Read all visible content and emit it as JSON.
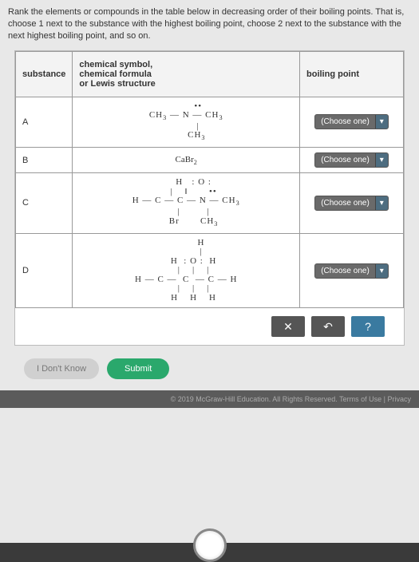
{
  "instructions": "Rank the elements or compounds in the table below in decreasing order of their boiling points. That is, choose 1 next to the substance with the highest boiling point, choose 2 next to the substance with the next highest boiling point, and so on.",
  "headers": {
    "substance": "substance",
    "formula": "chemical symbol,\nchemical formula\nor Lewis structure",
    "boiling": "boiling point"
  },
  "rows": {
    "a": {
      "label": "A",
      "formula": "trimethylamine_lewis",
      "choose": "(Choose one)"
    },
    "b": {
      "label": "B",
      "formula": "CaBr2",
      "choose": "(Choose one)"
    },
    "c": {
      "label": "C",
      "formula": "bromo_methylamide_lewis",
      "choose": "(Choose one)"
    },
    "d": {
      "label": "D",
      "formula": "methylpropanol_lewis",
      "choose": "(Choose one)"
    }
  },
  "controls": {
    "clear": "✕",
    "undo": "↶",
    "help": "?"
  },
  "actions": {
    "dontknow": "I Don't Know",
    "submit": "Submit"
  },
  "footer": "© 2019 McGraw-Hill Education. All Rights Reserved.   Terms of Use  |  Privacy"
}
